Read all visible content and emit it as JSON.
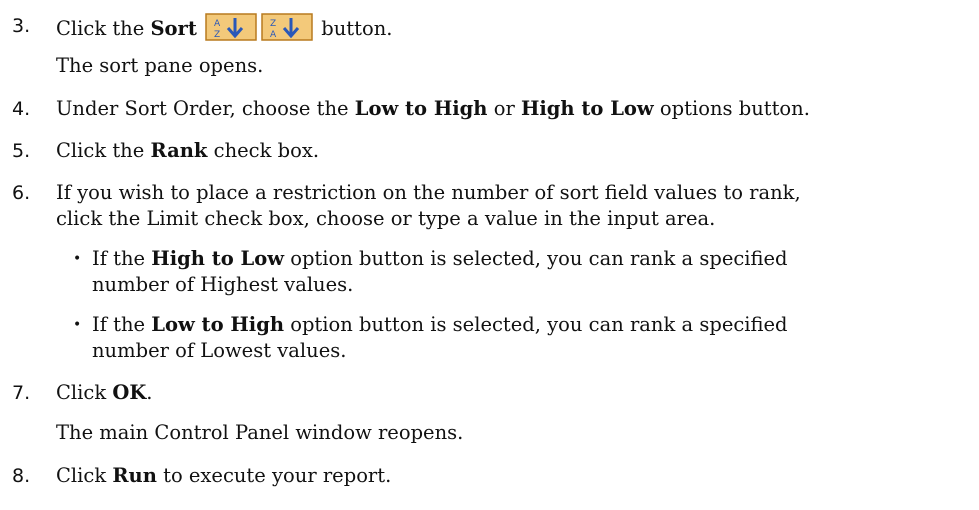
{
  "steps": [
    {
      "number": "3.",
      "pre": "Click the ",
      "bold": "Sort",
      "post": " button.",
      "result": "The sort pane opens.",
      "icons": [
        "sort-ascending-icon",
        "sort-descending-icon"
      ]
    },
    {
      "number": "4.",
      "pre": "Under Sort Order, choose the ",
      "bold1": "Low to High",
      "mid": " or ",
      "bold2": "High to Low",
      "post": " options button."
    },
    {
      "number": "5.",
      "pre": "Click the ",
      "bold": "Rank",
      "post": " check box."
    },
    {
      "number": "6.",
      "line1": "If you wish to place a restriction on the number of sort field values to rank,",
      "line2": "click the Limit check box, choose or type a value in the input area.",
      "bullets": [
        {
          "pre": "If the ",
          "bold": "High to Low",
          "post": " option button is selected, you can rank a specified",
          "line2": "number of Highest values."
        },
        {
          "pre": "If the ",
          "bold": "Low to High",
          "post": " option button is selected, you can rank a specified",
          "line2": "number of Lowest values."
        }
      ]
    },
    {
      "number": "7.",
      "pre": "Click ",
      "bold": "OK",
      "post": ".",
      "result": "The main Control Panel window reopens."
    },
    {
      "number": "8.",
      "pre": "Click ",
      "bold": "Run",
      "post": " to execute your report."
    }
  ],
  "bullet_glyph": "•",
  "colors": {
    "text": "#111111",
    "icon_bg": "#f3c97a",
    "icon_border": "#b87a1f",
    "icon_arrow": "#2a58b8"
  }
}
